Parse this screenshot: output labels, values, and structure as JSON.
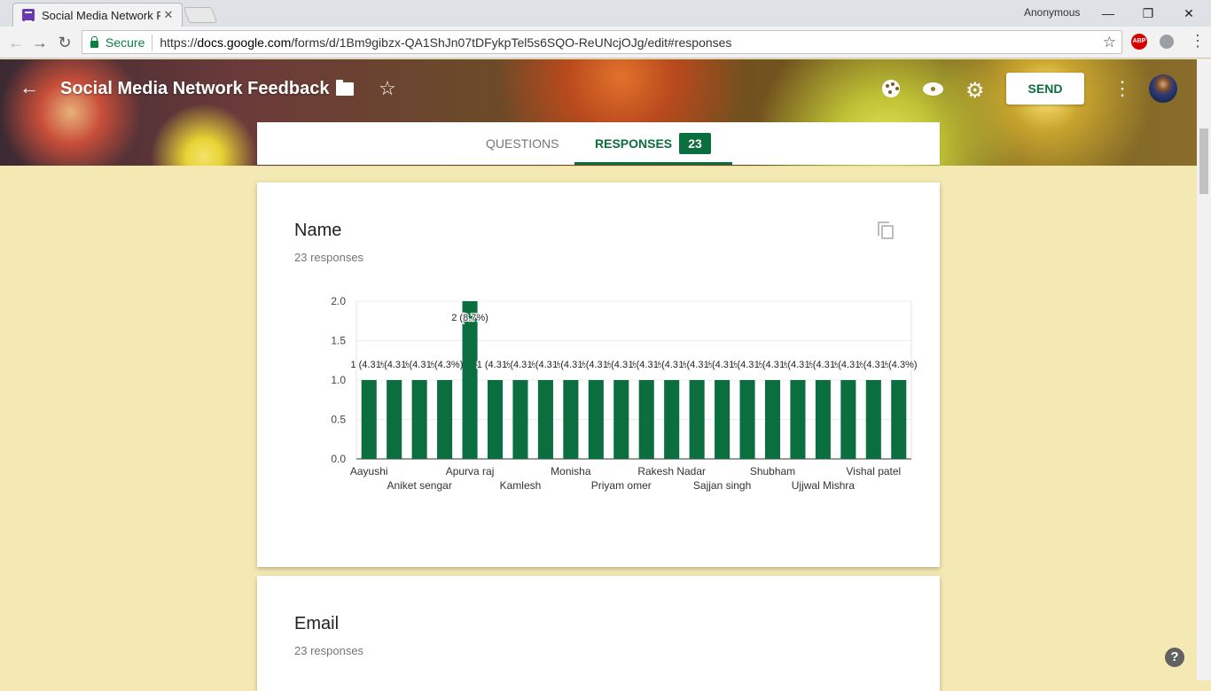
{
  "browser": {
    "tab_title": "Social Media Network Fe",
    "tab_close": "✕",
    "incognito_label": "Anonymous",
    "secure_label": "Secure",
    "url_prefix": "https://",
    "url_host": "docs.google.com",
    "url_path": "/forms/d/1Bm9gibzx-QA1ShJn07tDFykpTel5s6SQO-ReUNcjOJg/edit#responses",
    "abp_label": "ABP"
  },
  "header": {
    "title": "Social Media Network Feedback",
    "send_label": "SEND"
  },
  "tabs": {
    "questions_label": "QUESTIONS",
    "responses_label": "RESPONSES",
    "responses_count": "23"
  },
  "questions": [
    {
      "title": "Name",
      "subtitle": "23 responses"
    },
    {
      "title": "Email",
      "subtitle": "23 responses"
    }
  ],
  "chart_data": {
    "type": "bar",
    "ylim": [
      0,
      2
    ],
    "yticks": [
      "2.0",
      "1.5",
      "1.0",
      "0.5",
      "0.0"
    ],
    "values": [
      1,
      1,
      1,
      1,
      2,
      1,
      1,
      1,
      1,
      1,
      1,
      1,
      1,
      1,
      1,
      1,
      1,
      1,
      1,
      1,
      1,
      1
    ],
    "bar_labels": [
      "1 (4.3%)",
      "1 (4.3%)",
      "1 (4.3%)",
      "1 (4.3%)",
      "2 (8.7%)",
      "1 (4.3%)",
      "1 (4.3%)",
      "1 (4.3%)",
      "1 (4.3%)",
      "1 (4.3%)",
      "1 (4.3%)",
      "1 (4.3%)",
      "1 (4.3%)",
      "1 (4.3%)",
      "1 (4.3%)",
      "1 (4.3%)",
      "1 (4.3%)",
      "1 (4.3%)",
      "1 (4.3%)",
      "1 (4.3%)",
      "1 (4.3%)",
      "1 (4.3%)"
    ],
    "visible_category_labels": [
      {
        "bar": 0,
        "text": "Aayushi",
        "row": 0
      },
      {
        "bar": 2,
        "text": "Aniket sengar",
        "row": 1
      },
      {
        "bar": 4,
        "text": "Apurva raj",
        "row": 0
      },
      {
        "bar": 6,
        "text": "Kamlesh",
        "row": 1
      },
      {
        "bar": 8,
        "text": "Monisha",
        "row": 0
      },
      {
        "bar": 10,
        "text": "Priyam omer",
        "row": 1
      },
      {
        "bar": 12,
        "text": "Rakesh Nadar",
        "row": 0
      },
      {
        "bar": 14,
        "text": "Sajjan singh",
        "row": 1
      },
      {
        "bar": 16,
        "text": "Shubham",
        "row": 0
      },
      {
        "bar": 18,
        "text": "Ujjwal Mishra",
        "row": 1
      },
      {
        "bar": 20,
        "text": "Vishal patel",
        "row": 0
      }
    ],
    "bar_color": "#0b6e3f",
    "grid": true
  },
  "colors": {
    "accent": "#0b6e3f",
    "background": "#f4e8b3"
  }
}
